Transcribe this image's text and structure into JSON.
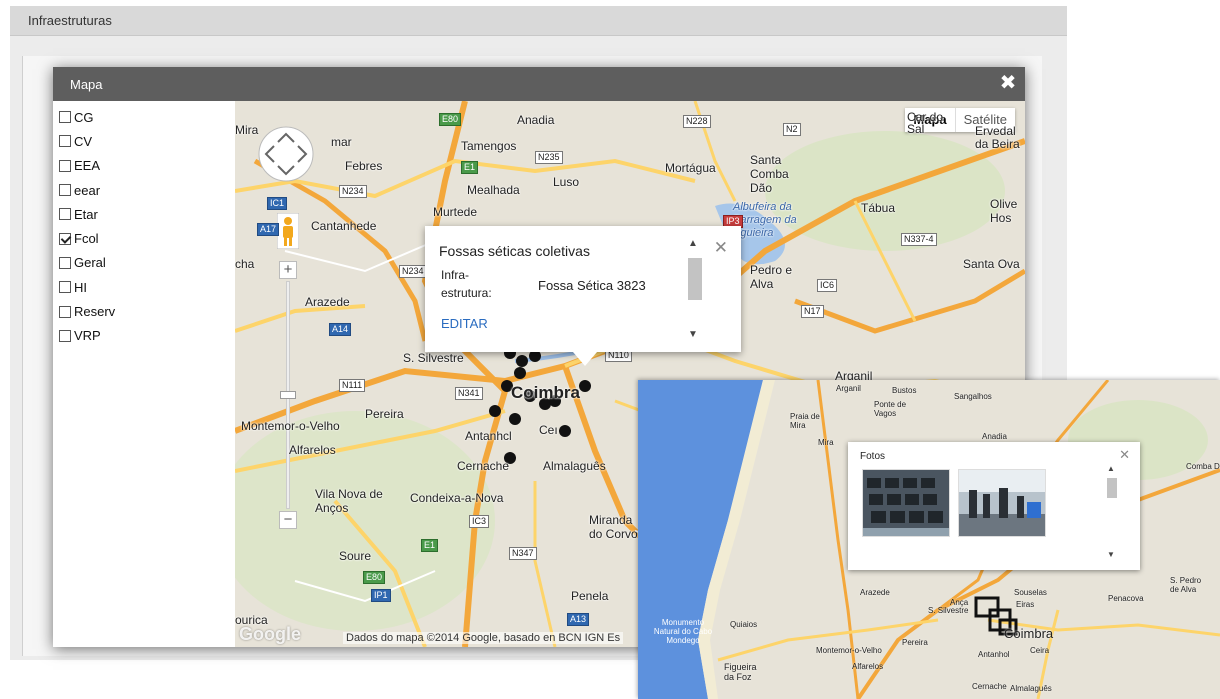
{
  "page": {
    "header_title": "Infraestruturas"
  },
  "modal": {
    "title": "Mapa",
    "close_glyph": "✖"
  },
  "layers": [
    {
      "label": "CG",
      "checked": false
    },
    {
      "label": "CV",
      "checked": false
    },
    {
      "label": "EEA",
      "checked": false
    },
    {
      "label": "eear",
      "checked": false
    },
    {
      "label": "Etar",
      "checked": false
    },
    {
      "label": "Fcol",
      "checked": true
    },
    {
      "label": "Geral",
      "checked": false
    },
    {
      "label": "HI",
      "checked": false
    },
    {
      "label": "Reserv",
      "checked": false
    },
    {
      "label": "VRP",
      "checked": false
    }
  ],
  "map": {
    "type_controls": {
      "map": "Mapa",
      "satellite": "Satélite"
    },
    "zoom_in": "+",
    "zoom_out": "−",
    "attribution": "Dados do mapa ©2014 Google, basado en BCN IGN Es",
    "logo": "Google",
    "places": {
      "anadia": "Anadia",
      "mira": "Mira",
      "tamengos": "Tamengos",
      "febres": "Febres",
      "mortagua": "Mortágua",
      "santa_comba_dao": "Santa Comba Dão",
      "mealhada": "Mealhada",
      "luso": "Luso",
      "murtede": "Murtede",
      "cantanhede": "Cantanhede",
      "albufeira": "Albufeira da Barragem da Aguieira",
      "tabua": "Tábua",
      "oliveira": "Olive Hos",
      "santa_ovaia": "Santa Ova",
      "pedro_alva": "Pedro e Alva",
      "arazede": "Arazede",
      "s_silvestre": "S. Silvestre",
      "arganil": "Arganil",
      "pereira": "Pereira",
      "montemor": "Montemor-o-Velho",
      "coimbra": "Coimbra",
      "antanhol": "Antanhcl",
      "ceira": "Ceı",
      "alfarelos": "Alfarelos",
      "cernache": "Cernache",
      "almalaguês": "Almalaguês",
      "vila_nova_ancos": "Vila Nova de Anços",
      "condeixa": "Condeixa-a-Nova",
      "miranda_corvo": "Miranda do Corvo",
      "soure": "Soure",
      "penela": "Penela",
      "carregal": "Car do Sal",
      "ervedal": "Ervedal da Beira",
      "cha": "cha",
      "mira_left": "Mira",
      "mmar": "mar",
      "ourica": "ourica"
    },
    "roads": [
      "E80",
      "N228",
      "N2",
      "N235",
      "N234",
      "E1",
      "IC1",
      "A17",
      "IP3",
      "N337-4",
      "N234",
      "IC6",
      "N17",
      "A14",
      "N110",
      "N111",
      "N341",
      "IC3",
      "N347",
      "E1",
      "E80",
      "IP1",
      "A13"
    ]
  },
  "infowindow": {
    "title": "Fossas séticas coletivas",
    "field_label": "Infra-estrutura:",
    "field_value": "Fossa Sética 3823",
    "edit_link": "EDITAR",
    "close_glyph": "✕",
    "scroll_up": "▲",
    "scroll_down": "▼"
  },
  "photo_map": {
    "fotos_title": "Fotos",
    "close_glyph": "✕",
    "scroll_up": "▲",
    "scroll_down": "▼",
    "places": {
      "arganil": "Arganil",
      "bustos": "Bustos",
      "sangalhos": "Sangalhos",
      "ponte_vagos": "Ponte de Vagos",
      "praia_mira": "Praia de Mira",
      "anadia": "Anadia",
      "mira": "Mira",
      "comba": "Comba D",
      "souselas": "Souselas",
      "arazede": "Arazede",
      "anca": "Ança",
      "penacova": "Penacova",
      "pedro_alva": "S. Pedro de Alva",
      "s_silvestre": "S. Silvestre",
      "eiras": "Eiras",
      "monumento": "Monumento Natural do Cabo Mondego",
      "quiaios": "Quiaios",
      "pereira": "Pereira",
      "coimbra": "Coimbra",
      "montemor": "Montemor-o-Velho",
      "antanhol": "Antanhol",
      "ceira": "Ceira",
      "alfarelos": "Alfarelos",
      "figueira": "Figueira da Foz",
      "cernache": "Cernache",
      "almalaguês": "Almalaguês"
    }
  },
  "colors": {
    "titlebar": "#5e5e5e",
    "land": "#e7e3d8",
    "sea": "#5d91dd",
    "highway": "#f3a73b",
    "road": "#fdd46a",
    "link": "#2a6cc0"
  }
}
